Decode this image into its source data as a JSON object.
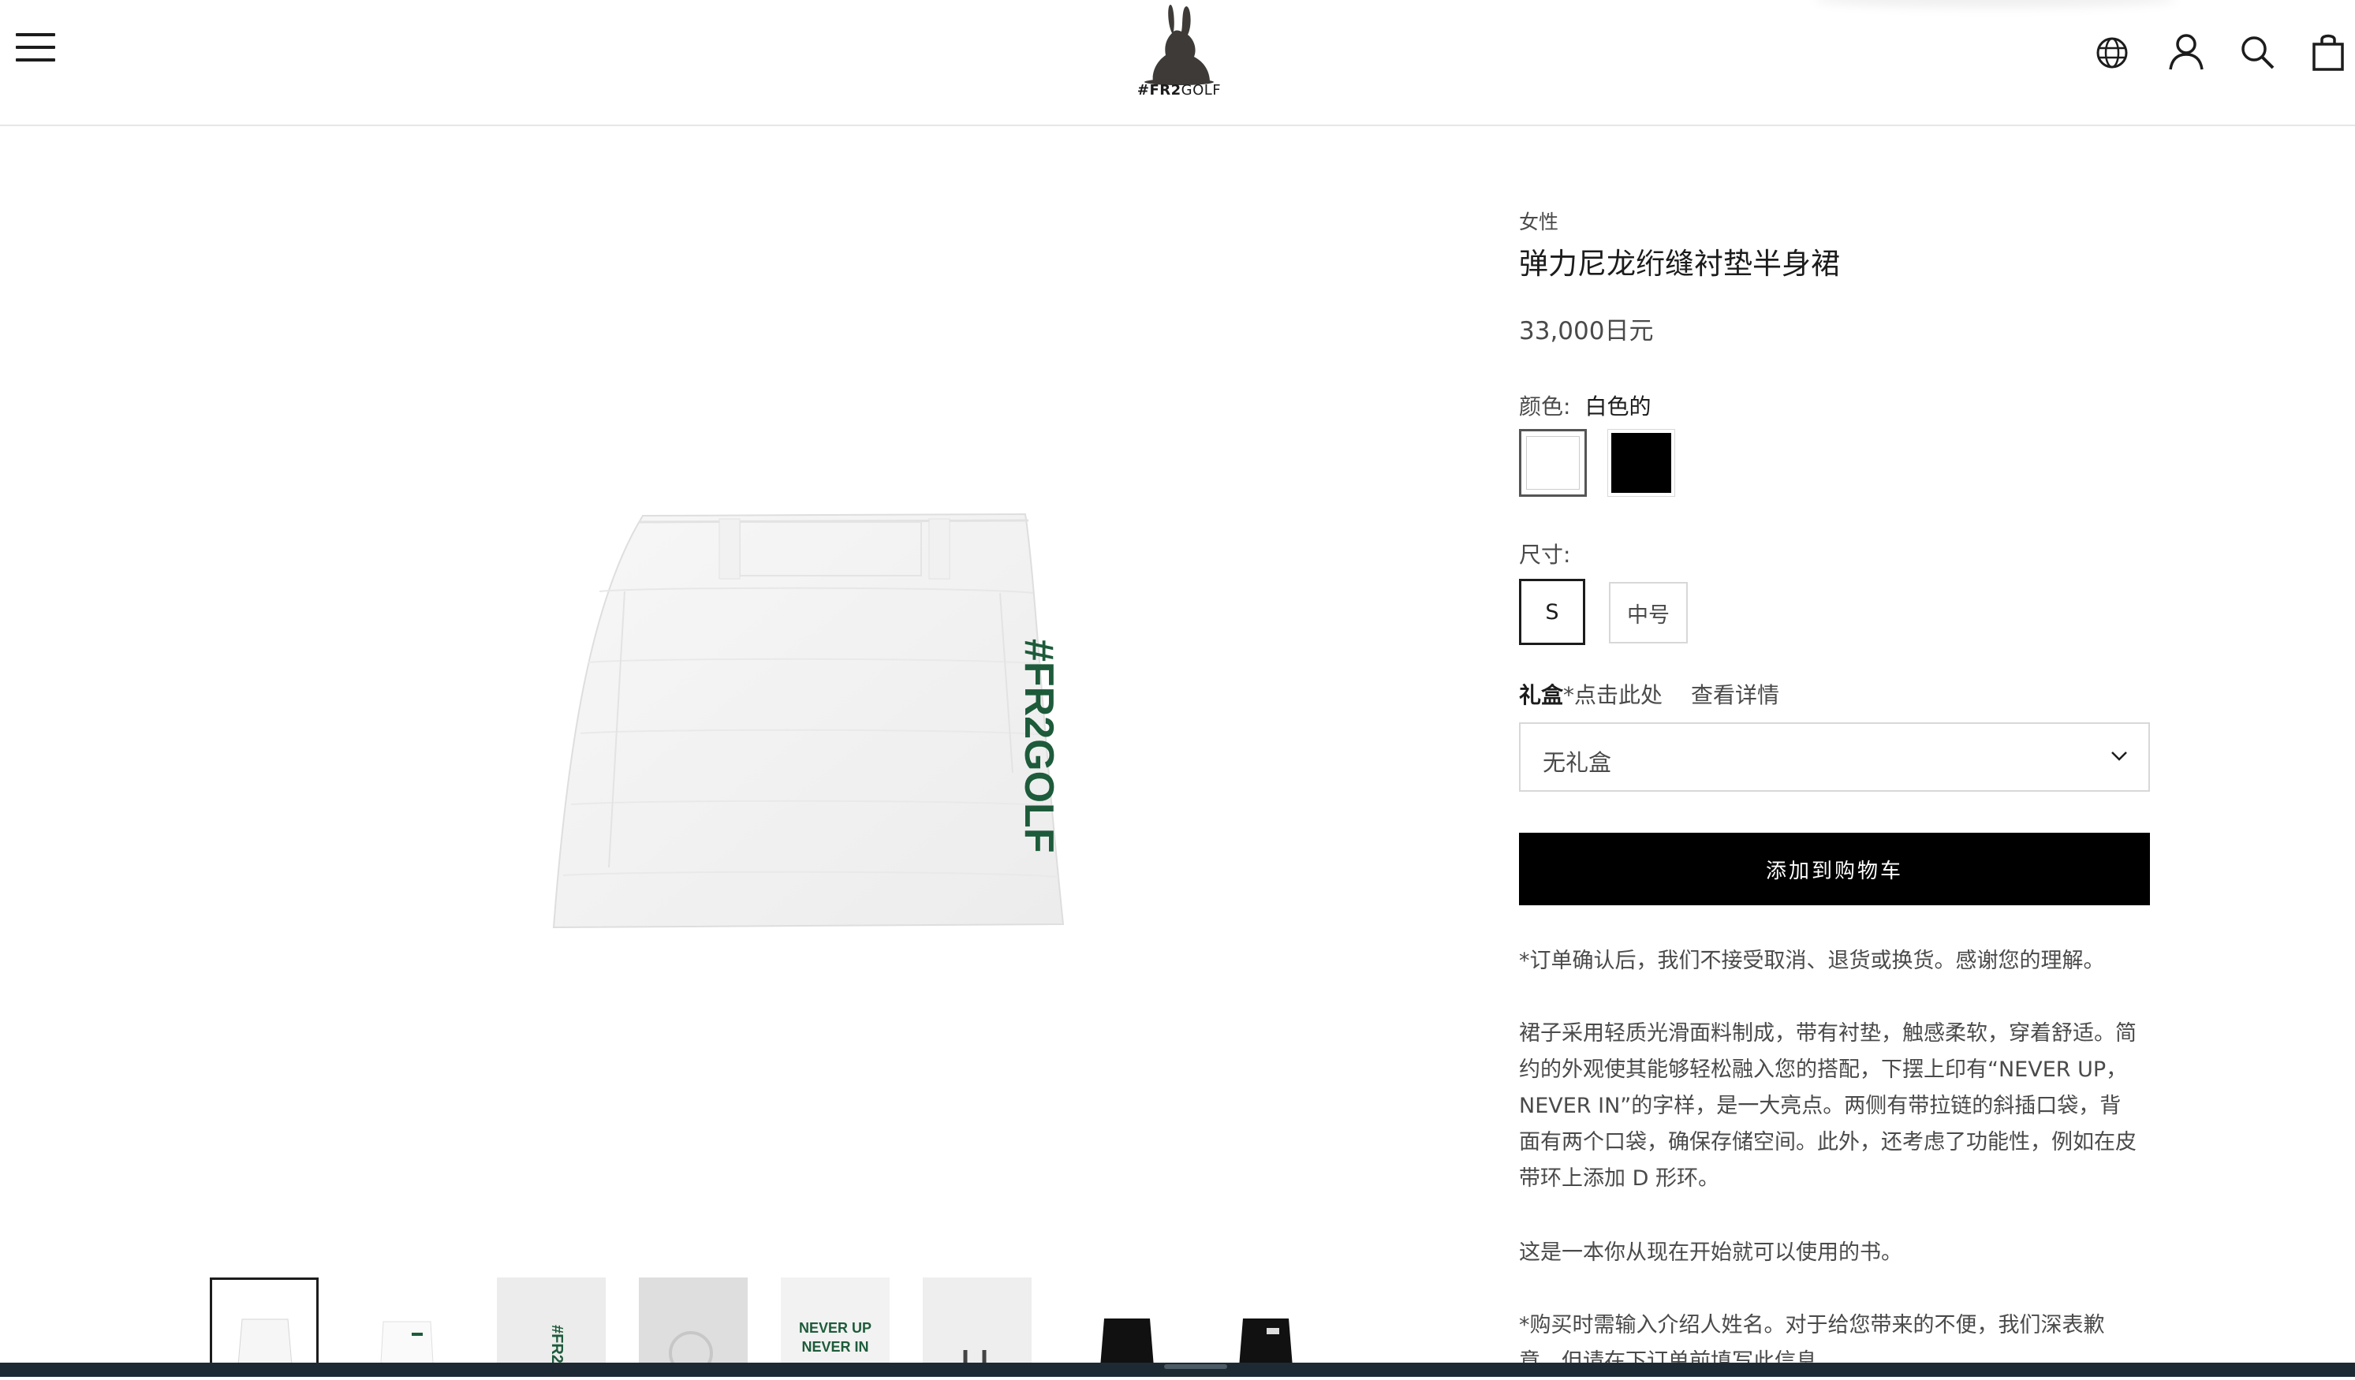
{
  "header": {
    "brand_strong": "#FR2",
    "brand_light": "GOLF",
    "icons": [
      "menu-icon",
      "globe-icon",
      "account-icon",
      "search-icon",
      "cart-icon"
    ]
  },
  "product": {
    "category": "女性",
    "title": "弹力尼龙绗缝衬垫半身裙",
    "price": "33,000日元",
    "color_label": "颜色:",
    "color_value": "白色的",
    "colors": [
      {
        "name": "white",
        "hex": "#ffffff",
        "selected": true
      },
      {
        "name": "black",
        "hex": "#000000",
        "selected": false
      }
    ],
    "size_label": "尺寸:",
    "sizes": [
      {
        "label": "S",
        "selected": true
      },
      {
        "label": "中号",
        "selected": false
      }
    ],
    "gift": {
      "strong": "礼盒",
      "rest": "*点击此处",
      "details": "查看详情",
      "selected": "无礼盒"
    },
    "add_to_cart": "添加到购物车",
    "notice": "*订单确认后，我们不接受取消、退货或换货。感谢您的理解。",
    "description": "裙子采用轻质光滑面料制成，带有衬垫，触感柔软，穿着舒适。简约的外观使其能够轻松融入您的搭配，下摆上印有“NEVER UP，NEVER IN”的字样，是一大亮点。两侧有带拉链的斜插口袋，背面有两个口袋，确保存储空间。此外，还考虑了功能性，例如在皮带环上添加 D 形环。",
    "book_line": "这是一本你从现在开始就可以使用的书。",
    "referral": "*购买时需输入介绍人姓名。对于给您带来的不便，我们深表歉意，但请在下订单前填写此信息"
  },
  "images": {
    "main_print": "#FR2GOLF",
    "thumb_print": "NEVER UP NEVER IN",
    "thumb_print_line1": "NEVER UP",
    "thumb_print_line2": "NEVER IN",
    "thumb_count": 8,
    "active_thumb": 0
  },
  "colors": {
    "accent_green": "#1d5b3a",
    "button_bg": "#000000",
    "text": "#1c1c1c",
    "muted": "#4a4a4a",
    "border": "#d8d8d8"
  }
}
